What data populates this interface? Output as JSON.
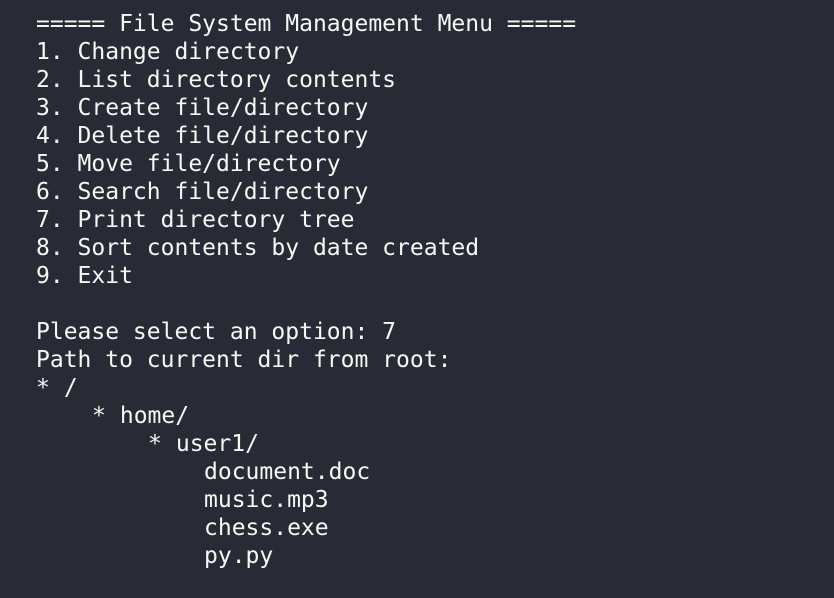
{
  "menu": {
    "title": "===== File System Management Menu =====",
    "items": [
      "1. Change directory",
      "2. List directory contents",
      "3. Create file/directory",
      "4. Delete file/directory",
      "5. Move file/directory",
      "6. Search file/directory",
      "7. Print directory tree",
      "8. Sort contents by date created",
      "9. Exit"
    ]
  },
  "session": {
    "prompt": "Please select an option: 7",
    "path_header": "Path to current dir from root:"
  },
  "tree": {
    "bullet": "*",
    "root": "/",
    "home": "home/",
    "user": "user1/",
    "files": [
      "document.doc",
      "music.mp3",
      "chess.exe",
      "py.py"
    ]
  }
}
